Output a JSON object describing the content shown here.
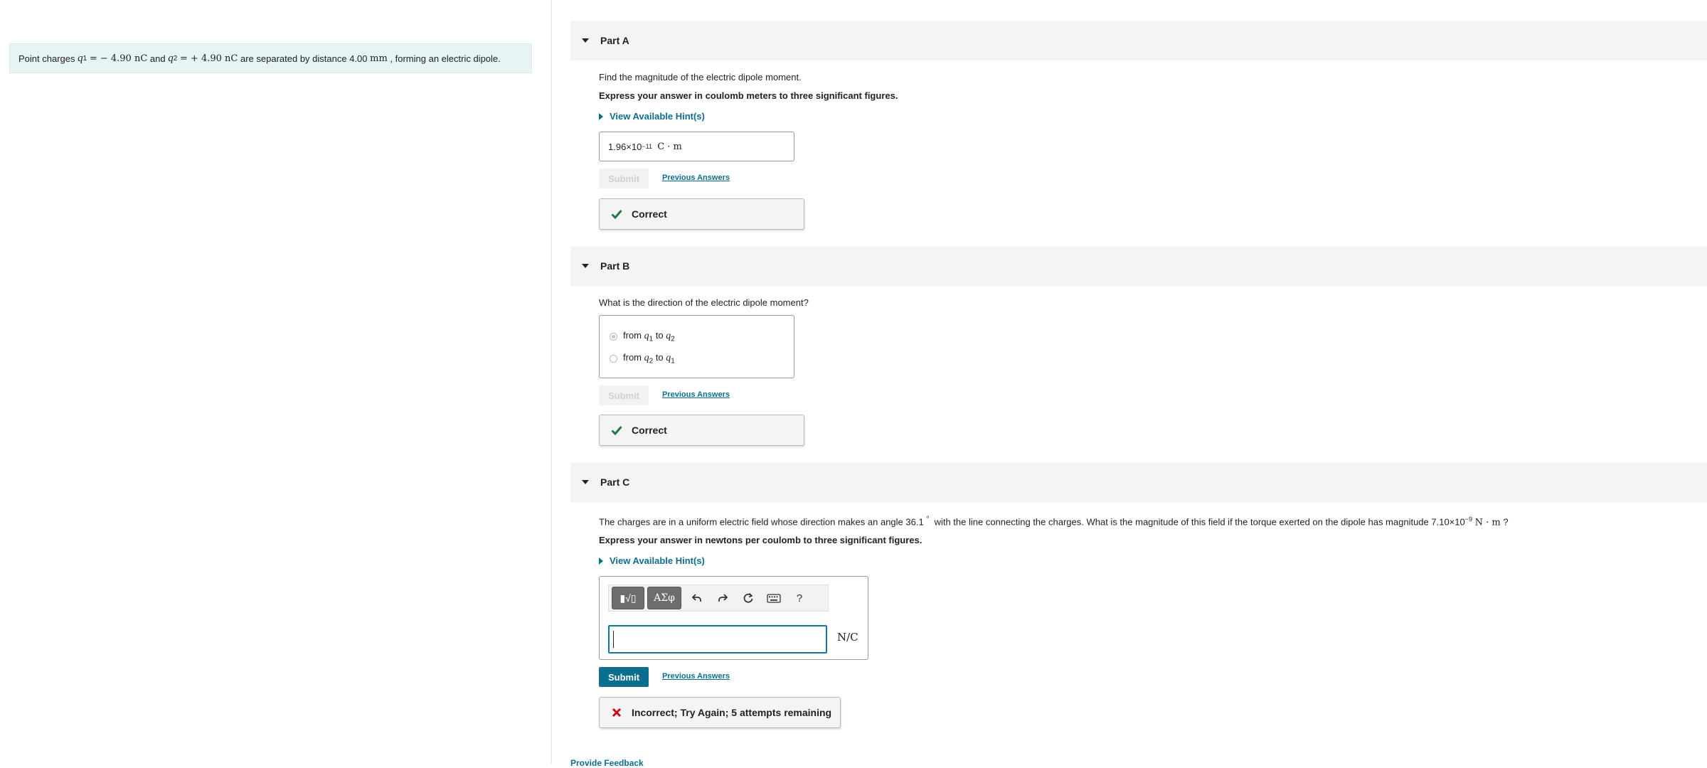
{
  "intro": {
    "prefix": "Point charges",
    "q1_var": "q",
    "q1_sub": "1",
    "q1_value": "= − 4.90 nC",
    "and1": "and",
    "q2_var": "q",
    "q2_sub": "2",
    "q2_value": "= + 4.90 nC",
    "mid": "are separated by distance 4.00",
    "distance_unit": "mm",
    "suffix": ", forming an electric dipole."
  },
  "partA": {
    "title": "Part A",
    "question": "Find the magnitude of the electric dipole moment.",
    "instruction": "Express your answer in coulomb meters to three significant figures.",
    "hint": "View Available Hint(s)",
    "answer_mantissa": "1.96×10",
    "answer_exp": "−11",
    "answer_unit": "C · m",
    "submit": "Submit",
    "previous": "Previous Answers",
    "feedback": "Correct"
  },
  "partB": {
    "title": "Part B",
    "question": "What is the direction of the electric dipole moment?",
    "options": [
      {
        "from": "from",
        "a_var": "q",
        "a_sub": "1",
        "to": "to",
        "b_var": "q",
        "b_sub": "2",
        "selected": true
      },
      {
        "from": "from",
        "a_var": "q",
        "a_sub": "2",
        "to": "to",
        "b_var": "q",
        "b_sub": "1",
        "selected": false
      }
    ],
    "submit": "Submit",
    "previous": "Previous Answers",
    "feedback": "Correct"
  },
  "partC": {
    "title": "Part C",
    "question_a": "The charges are in a uniform electric field whose direction makes an angle 36.1",
    "degree": "°",
    "question_b": "with the line connecting the charges. What is the magnitude of this field if the torque exerted on the dipole has magnitude 7.10×10",
    "torque_exp": "−9",
    "torque_unit": "N · m",
    "question_end": "?",
    "instruction": "Express your answer in newtons per coulomb to three significant figures.",
    "hint": "View Available Hint(s)",
    "toolbar": {
      "templates_label": "▮√▯",
      "symbols_label": "ΑΣφ",
      "undo_icon": "undo-icon",
      "redo_icon": "redo-icon",
      "reset_icon": "reset-icon",
      "keyboard_icon": "keyboard-icon",
      "help_label": "?"
    },
    "input_value": "",
    "units": "N/C",
    "submit": "Submit",
    "previous": "Previous Answers",
    "feedback": "Incorrect; Try Again; 5 attempts remaining"
  },
  "footer_link": "Provide Feedback",
  "colors": {
    "accent": "#0b6e8e",
    "correct": "#1e7f3c",
    "incorrect": "#d0021b",
    "intro_bg": "#e6f4f4"
  }
}
